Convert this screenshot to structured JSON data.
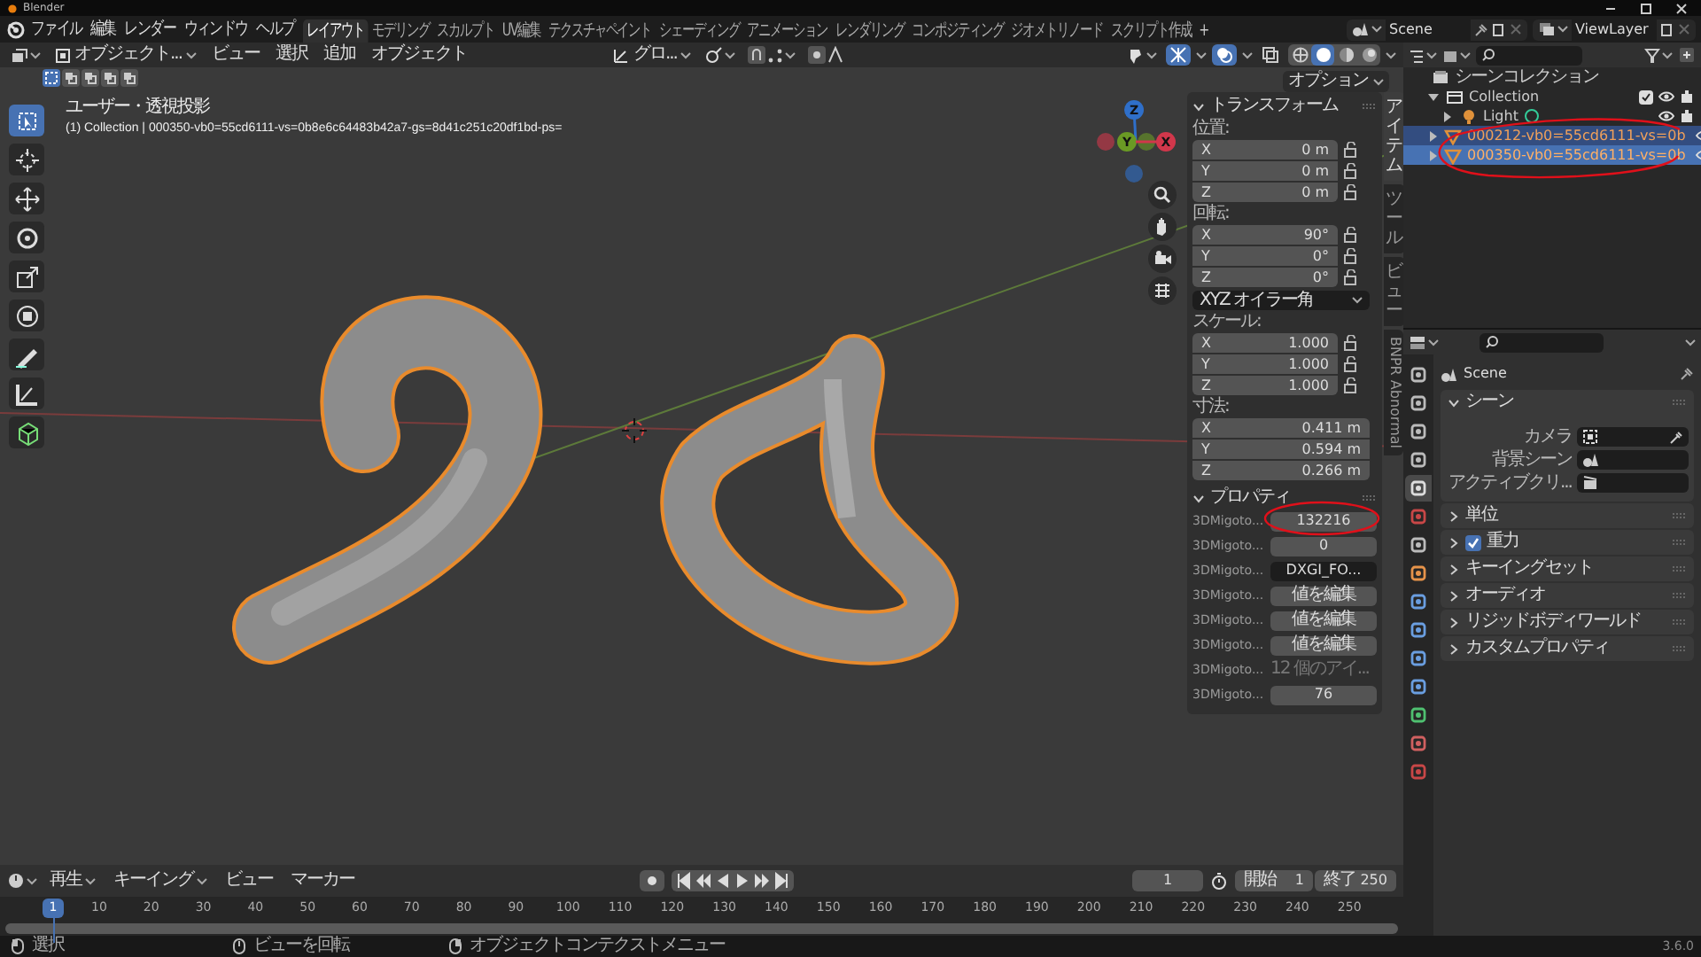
{
  "app": {
    "title": "Blender"
  },
  "menu": [
    "ファイル",
    "編集",
    "レンダー",
    "ウィンドウ",
    "ヘルプ"
  ],
  "workspaces": [
    {
      "label": "レイアウト",
      "selected": true
    },
    {
      "label": "モデリング",
      "selected": false
    },
    {
      "label": "スカルプト",
      "selected": false
    },
    {
      "label": "UV編集",
      "selected": false
    },
    {
      "label": "テクスチャペイント",
      "selected": false
    },
    {
      "label": "シェーディング",
      "selected": false
    },
    {
      "label": "アニメーション",
      "selected": false
    },
    {
      "label": "レンダリング",
      "selected": false
    },
    {
      "label": "コンポジティング",
      "selected": false
    },
    {
      "label": "ジオメトリノード",
      "selected": false
    },
    {
      "label": "スクリプト作成",
      "selected": false
    }
  ],
  "add_workspace": "+",
  "scene": "Scene",
  "view_layer": "ViewLayer",
  "viewport": {
    "mode": "オブジェクト...",
    "menus": [
      "ビュー",
      "選択",
      "追加",
      "オブジェクト"
    ],
    "orientation": "グロ...",
    "shading": [
      {
        "kind": "wireframe",
        "selected": false
      },
      {
        "kind": "solid",
        "selected": true
      },
      {
        "kind": "material",
        "selected": false
      },
      {
        "kind": "rendered",
        "selected": false
      }
    ],
    "select_modes": [
      {
        "selected": true
      },
      {
        "selected": false
      },
      {
        "selected": false
      },
      {
        "selected": false
      },
      {
        "selected": false
      }
    ],
    "options": "オプション",
    "view_name": "ユーザー・透視投影",
    "info": "(1) Collection | 000350-vb0=55cd6111-vs=0b8e6c64483b42a7-gs=8d41c251c20df1bd-ps=",
    "tools": [
      {
        "kind": "select",
        "selected": true
      },
      {
        "kind": "cursor",
        "selected": false
      },
      {
        "kind": "move",
        "selected": false
      },
      {
        "kind": "rotate",
        "selected": false
      },
      {
        "kind": "scale",
        "selected": false
      },
      {
        "kind": "transform",
        "selected": false
      },
      {
        "kind": "annotate",
        "selected": false
      },
      {
        "kind": "measure",
        "selected": false
      },
      {
        "kind": "add-cube",
        "selected": false
      }
    ],
    "gizmo": [
      {
        "kind": "z",
        "label": "Z"
      },
      {
        "kind": "y",
        "label": "Y"
      },
      {
        "kind": "x",
        "label": "X"
      }
    ]
  },
  "sidebar": {
    "tabs": [
      {
        "label": "アイテム",
        "kind": "stacked",
        "selected": true
      },
      {
        "label": "ツール",
        "kind": "stacked",
        "selected": false
      },
      {
        "label": "ビュー",
        "kind": "stacked",
        "selected": false
      },
      {
        "label": "BNPR Abnormal",
        "kind": "rotated",
        "selected": false
      }
    ],
    "transform": {
      "title": "トランスフォーム",
      "expanded": true,
      "items": [
        {
          "kind": "label",
          "text": "位置:"
        },
        {
          "kind": "vector",
          "lockable": true,
          "rows": [
            {
              "axis": "X",
              "value": "0 m"
            },
            {
              "axis": "Y",
              "value": "0 m"
            },
            {
              "axis": "Z",
              "value": "0 m"
            }
          ]
        },
        {
          "kind": "label",
          "text": "回転:"
        },
        {
          "kind": "vector",
          "lockable": true,
          "rows": [
            {
              "axis": "X",
              "value": "90°"
            },
            {
              "axis": "Y",
              "value": "0°"
            },
            {
              "axis": "Z",
              "value": "0°"
            }
          ]
        },
        {
          "kind": "dropdown",
          "text": "XYZ オイラー角"
        },
        {
          "kind": "label",
          "text": "スケール:"
        },
        {
          "kind": "vector",
          "lockable": true,
          "rows": [
            {
              "axis": "X",
              "value": "1.000"
            },
            {
              "axis": "Y",
              "value": "1.000"
            },
            {
              "axis": "Z",
              "value": "1.000"
            }
          ]
        },
        {
          "kind": "label",
          "text": "寸法:"
        },
        {
          "kind": "vector",
          "lockable": false,
          "rows": [
            {
              "axis": "X",
              "value": "0.411 m"
            },
            {
              "axis": "Y",
              "value": "0.594 m"
            },
            {
              "axis": "Z",
              "value": "0.266 m"
            }
          ]
        }
      ]
    },
    "properties": {
      "title": "プロパティ",
      "expanded": true,
      "rows": [
        {
          "label": "3DMigoto...",
          "kind": "number",
          "value": "132216"
        },
        {
          "label": "3DMigoto...",
          "kind": "number",
          "value": "0"
        },
        {
          "label": "3DMigoto...",
          "kind": "text",
          "value": "DXGI_FO..."
        },
        {
          "label": "3DMigoto...",
          "kind": "button",
          "value": "値を編集"
        },
        {
          "label": "3DMigoto...",
          "kind": "button",
          "value": "値を編集"
        },
        {
          "label": "3DMigoto...",
          "kind": "button",
          "value": "値を編集"
        },
        {
          "label": "3DMigoto...",
          "kind": "info",
          "value": "12 個のアイ..."
        },
        {
          "label": "3DMigoto...",
          "kind": "number",
          "value": "76"
        }
      ]
    }
  },
  "outliner": {
    "tree": [
      {
        "label": "シーンコレクション",
        "kind": "scene_collection",
        "selected": false,
        "children": [
          {
            "label": "Collection",
            "kind": "collection",
            "selected": false,
            "expanded": true,
            "checked": true,
            "children": [
              {
                "label": "Light",
                "kind": "light",
                "selected": false,
                "active": false,
                "expanded": false
              }
            ]
          },
          {
            "label": "000212-vb0=55cd6111-vs=0b",
            "kind": "mesh",
            "selected": true,
            "active": false,
            "expanded": false
          },
          {
            "label": "000350-vb0=55cd6111-vs=0b",
            "kind": "mesh",
            "selected": true,
            "active": true,
            "expanded": false
          }
        ]
      }
    ]
  },
  "properties": {
    "tabs": [
      {
        "kind": "tool",
        "selected": false
      },
      {
        "kind": "render",
        "selected": false
      },
      {
        "kind": "output",
        "selected": false
      },
      {
        "kind": "view_layer",
        "selected": false
      },
      {
        "kind": "scene",
        "selected": true
      },
      {
        "kind": "world",
        "selected": false
      },
      {
        "kind": "collection",
        "selected": false
      },
      {
        "kind": "object",
        "selected": false
      },
      {
        "kind": "modifiers",
        "selected": false
      },
      {
        "kind": "particles",
        "selected": false
      },
      {
        "kind": "physics",
        "selected": false
      },
      {
        "kind": "constraints",
        "selected": false
      },
      {
        "kind": "data",
        "selected": false
      },
      {
        "kind": "material",
        "selected": false
      },
      {
        "kind": "texture",
        "selected": false
      }
    ],
    "context": "Scene",
    "panel": {
      "title": "シーン",
      "expanded": true,
      "fields": [
        {
          "label": "カメラ",
          "kind": "camera"
        },
        {
          "label": "背景シーン",
          "kind": "scene"
        },
        {
          "label": "アクティブクリ...",
          "kind": "clip"
        }
      ]
    },
    "collapsed": [
      {
        "title": "単位",
        "expanded": false
      },
      {
        "title": "重力",
        "expanded": false,
        "checked": true
      },
      {
        "title": "キーイングセット",
        "expanded": false
      },
      {
        "title": "オーディオ",
        "expanded": false
      },
      {
        "title": "リジッドボディワールド",
        "expanded": false
      },
      {
        "title": "カスタムプロパティ",
        "expanded": false
      }
    ]
  },
  "timeline": {
    "menus": [
      {
        "label": "再生",
        "dropdown": true
      },
      {
        "label": "キーイング",
        "dropdown": true
      },
      {
        "label": "ビュー",
        "dropdown": false
      },
      {
        "label": "マーカー",
        "dropdown": false
      }
    ],
    "current_frame": "1",
    "start_label": "開始",
    "start": "1",
    "end_label": "終了",
    "end": "250",
    "playhead": "1",
    "ticks": [
      "10",
      "20",
      "30",
      "40",
      "50",
      "60",
      "70",
      "80",
      "90",
      "100",
      "110",
      "120",
      "130",
      "140",
      "150",
      "160",
      "170",
      "180",
      "190",
      "200",
      "210",
      "220",
      "230",
      "240",
      "250"
    ]
  },
  "status_bar": {
    "items": [
      {
        "kind": "left",
        "text": "選択"
      },
      {
        "kind": "middle",
        "text": "ビューを回転"
      },
      {
        "kind": "right",
        "text": "オブジェクトコンテクストメニュー"
      }
    ],
    "version": "3.6.0"
  }
}
